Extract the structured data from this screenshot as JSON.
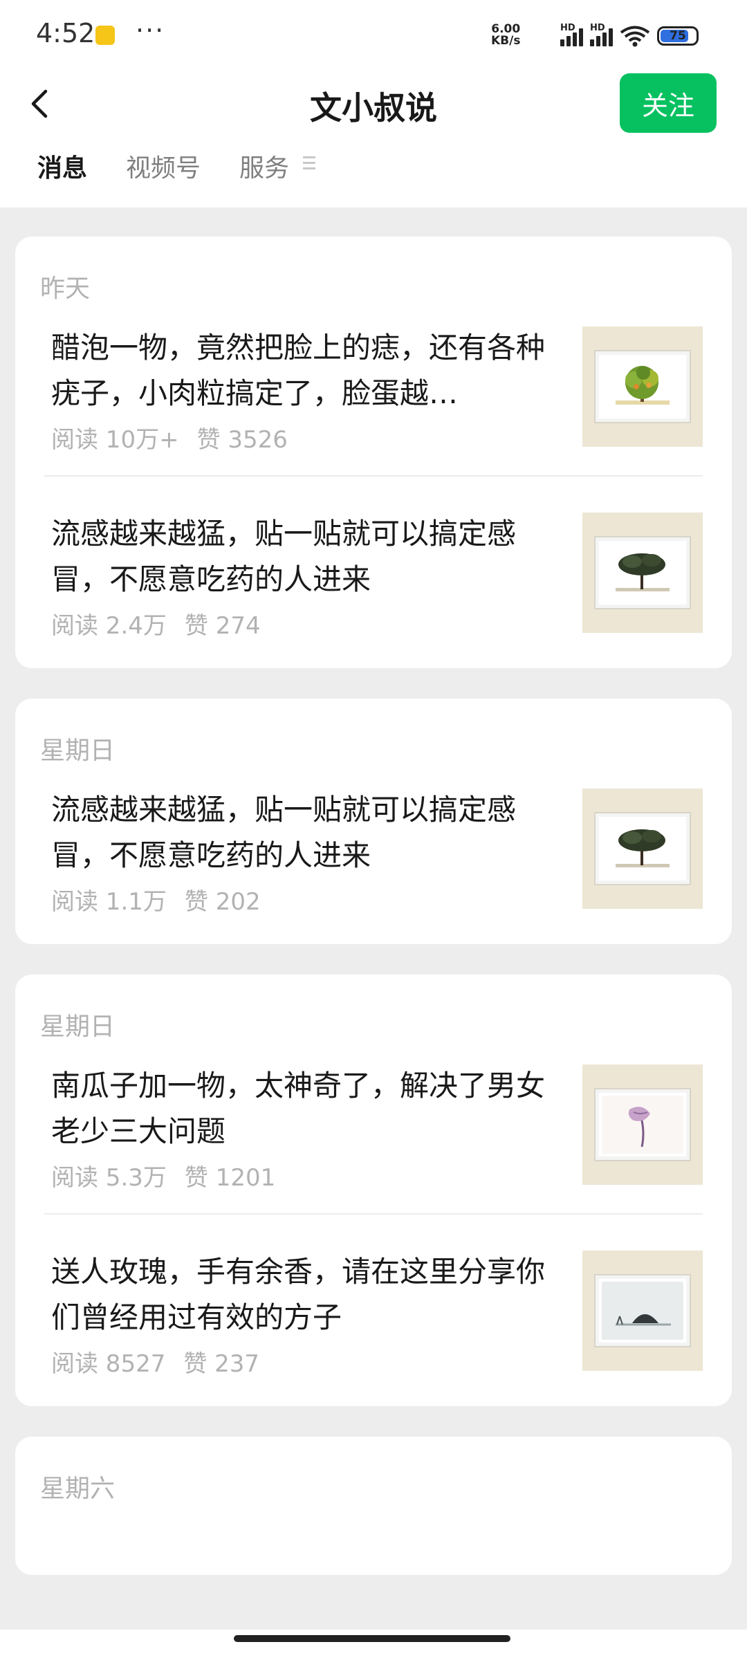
{
  "status_bar": {
    "time": "4:52",
    "dots": "···",
    "net_speed_value": "6.00",
    "net_speed_unit": "KB/s",
    "signal1_label": "HD",
    "signal2_label": "HD",
    "battery": "75"
  },
  "header": {
    "title": "文小叔说",
    "follow_label": "关注",
    "tabs": [
      {
        "label": "消息"
      },
      {
        "label": "视频号"
      },
      {
        "label": "服务"
      }
    ]
  },
  "feed": [
    {
      "date": "昨天",
      "articles": [
        {
          "title": "醋泡一物，竟然把脸上的痣，还有各种疣子，小肉粒搞定了，脸蛋越…",
          "reads": "阅读 10万+",
          "likes": "赞 3526",
          "thumb_icon": "green-tree-painting"
        },
        {
          "title": "流感越来越猛，贴一贴就可以搞定感冒，不愿意吃药的人进来",
          "reads": "阅读 2.4万",
          "likes": "赞 274",
          "thumb_icon": "dark-tree-painting"
        }
      ]
    },
    {
      "date": "星期日",
      "articles": [
        {
          "title": "流感越来越猛，贴一贴就可以搞定感冒，不愿意吃药的人进来",
          "reads": "阅读 1.1万",
          "likes": "赞 202",
          "thumb_icon": "dark-tree-painting"
        }
      ]
    },
    {
      "date": "星期日",
      "articles": [
        {
          "title": "南瓜子加一物，太神奇了，解决了男女老少三大问题",
          "reads": "阅读 5.3万",
          "likes": "赞 1201",
          "thumb_icon": "lotus-painting"
        },
        {
          "title": "送人玫瑰，手有余香，请在这里分享你们曾经用过有效的方子",
          "reads": "阅读 8527",
          "likes": "赞 237",
          "thumb_icon": "landscape-painting"
        }
      ]
    },
    {
      "date": "星期六",
      "articles": []
    }
  ],
  "colors": {
    "accent": "#07c160",
    "background": "#ededed",
    "muted_text": "#b2b2b2"
  }
}
